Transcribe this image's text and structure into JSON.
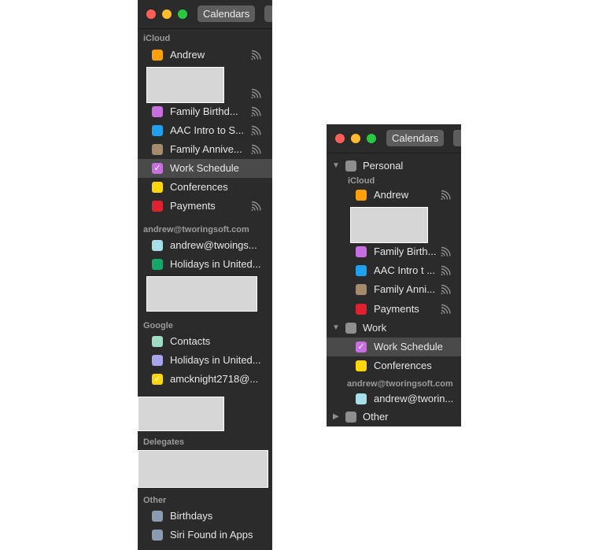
{
  "toolbar": {
    "calendars_label": "Calendars"
  },
  "left_panel": {
    "icloud_header": "iCloud",
    "icloud_items": [
      {
        "label": "Andrew",
        "color": "#ff9f0a",
        "checked": false,
        "shared": true
      },
      {
        "label": "Family Birthd...",
        "color": "#c76fe0",
        "checked": false,
        "shared": true
      },
      {
        "label": "AAC Intro to S...",
        "color": "#1ea2f0",
        "checked": false,
        "shared": true
      },
      {
        "label": "Family Annive...",
        "color": "#a58b6b",
        "checked": false,
        "shared": true
      },
      {
        "label": "Work Schedule",
        "color": "#c76fe0",
        "checked": true,
        "shared": false,
        "selected": true
      },
      {
        "label": "Conferences",
        "color": "#ffd60a",
        "checked": false,
        "shared": false
      },
      {
        "label": "Payments",
        "color": "#e0202e",
        "checked": false,
        "shared": true
      }
    ],
    "account_header": "andrew@tworingsoft.com",
    "account_items": [
      {
        "label": "andrew@twoings...",
        "color": "#a8e0ea",
        "checked": false
      },
      {
        "label": "Holidays in United...",
        "color": "#14a86a",
        "checked": false
      }
    ],
    "google_header": "Google",
    "google_items": [
      {
        "label": "Contacts",
        "color": "#9fdcc4",
        "checked": false
      },
      {
        "label": "Holidays in United...",
        "color": "#a7a5ec",
        "checked": false
      },
      {
        "label": "amcknight2718@...",
        "color": "#ffd60a",
        "checked": true
      }
    ],
    "delegates_header": "Delegates",
    "other_header": "Other",
    "other_items": [
      {
        "label": "Birthdays",
        "color": "#8b9bb2",
        "checked": false
      },
      {
        "label": "Siri Found in Apps",
        "color": "#8b9bb2",
        "checked": false
      }
    ]
  },
  "right_panel": {
    "groups": {
      "personal": {
        "label": "Personal"
      },
      "work": {
        "label": "Work"
      },
      "other": {
        "label": "Other"
      }
    },
    "icloud_header": "iCloud",
    "personal_items": [
      {
        "label": "Andrew",
        "color": "#ff9f0a",
        "checked": false,
        "shared": true
      },
      {
        "label": "Family Birth...",
        "color": "#c76fe0",
        "checked": false,
        "shared": true
      },
      {
        "label": "AAC Intro t ...",
        "color": "#1ea2f0",
        "checked": false,
        "shared": true
      },
      {
        "label": "Family Anni...",
        "color": "#a58b6b",
        "checked": false,
        "shared": true
      },
      {
        "label": "Payments",
        "color": "#e0202e",
        "checked": false,
        "shared": true
      }
    ],
    "work_items": [
      {
        "label": "Work Schedule",
        "color": "#c76fe0",
        "checked": true,
        "selected": true
      },
      {
        "label": "Conferences",
        "color": "#ffd60a",
        "checked": false
      }
    ],
    "account_header": "andrew@tworingsoft.com",
    "account_items": [
      {
        "label": "andrew@tworin...",
        "color": "#a8e0ea",
        "checked": false
      }
    ]
  }
}
